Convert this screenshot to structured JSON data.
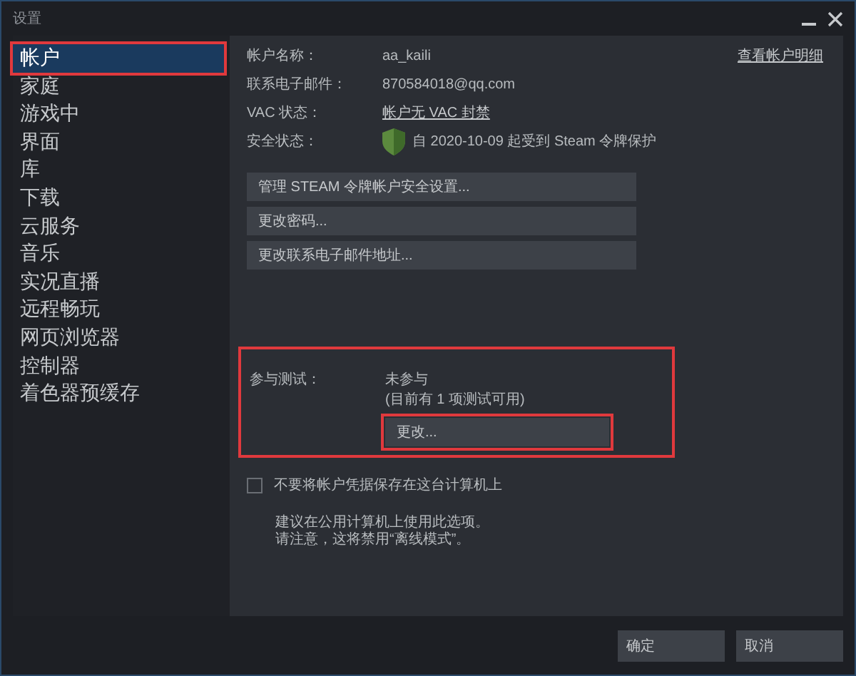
{
  "window": {
    "title": "设置"
  },
  "sidebar": {
    "items": [
      {
        "label": "帐户",
        "selected": true,
        "highlighted": true
      },
      {
        "label": "家庭",
        "selected": false,
        "highlighted": false
      },
      {
        "label": "游戏中",
        "selected": false,
        "highlighted": false
      },
      {
        "label": "界面",
        "selected": false,
        "highlighted": false
      },
      {
        "label": "库",
        "selected": false,
        "highlighted": false
      },
      {
        "label": "下载",
        "selected": false,
        "highlighted": false
      },
      {
        "label": "云服务",
        "selected": false,
        "highlighted": false
      },
      {
        "label": "音乐",
        "selected": false,
        "highlighted": false
      },
      {
        "label": "实况直播",
        "selected": false,
        "highlighted": false
      },
      {
        "label": "远程畅玩",
        "selected": false,
        "highlighted": false
      },
      {
        "label": "网页浏览器",
        "selected": false,
        "highlighted": false
      },
      {
        "label": "控制器",
        "selected": false,
        "highlighted": false
      },
      {
        "label": "着色器预缓存",
        "selected": false,
        "highlighted": false
      }
    ]
  },
  "account": {
    "details_link": "查看帐户明细",
    "fields": [
      {
        "label": "帐户名称：",
        "value": "aa_kaili",
        "kind": "text"
      },
      {
        "label": "联系电子邮件：",
        "value": "870584018@qq.com",
        "kind": "text"
      },
      {
        "label": "VAC 状态：",
        "value": "帐户无 VAC 封禁",
        "kind": "link"
      },
      {
        "label": "安全状态：",
        "value": "自 2020-10-09 起受到 Steam 令牌保护",
        "kind": "shield"
      }
    ],
    "buttons": [
      "管理 STEAM 令牌帐户安全设置...",
      "更改密码...",
      "更改联系电子邮件地址..."
    ]
  },
  "beta": {
    "label": "参与测试：",
    "status": "未参与",
    "note": "(目前有 1 项测试可用)",
    "button": "更改...",
    "highlighted": true,
    "button_highlighted": true
  },
  "remember": {
    "label": "不要将帐户凭据保存在这台计算机上",
    "checked": false,
    "note_lines": [
      "建议在公用计算机上使用此选项。",
      "请注意，这将禁用“离线模式”。"
    ]
  },
  "footer": {
    "buttons": [
      "确定",
      "取消"
    ]
  }
}
